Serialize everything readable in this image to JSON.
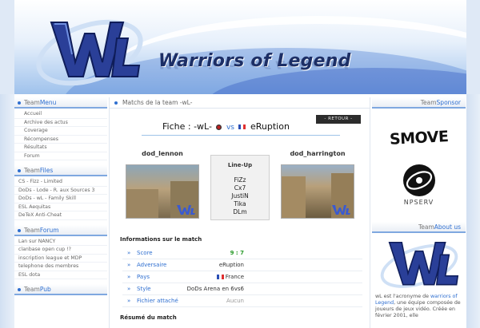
{
  "header": {
    "site_title": "Warriors of Legend"
  },
  "left_sidebar": {
    "menu_box": {
      "prefix": "Team",
      "highlight": "Menu",
      "items": [
        "Accueil",
        "Archive des actus",
        "Coverage",
        "Récompenses",
        "Résultats",
        "Forum"
      ]
    },
    "files_box": {
      "prefix": "Team",
      "highlight": "Files",
      "items": [
        "CS - Fizz - Limited",
        "DoDs - Lode - R. aux Sources 3",
        "DoDs - wL - Family Skill",
        "ESL Aequitas",
        "DeTeX Anti-Cheat"
      ]
    },
    "forum_box": {
      "prefix": "Team",
      "highlight": "Forum",
      "items": [
        "Lan sur NANCY",
        "clanbase open cup !?",
        "inscription league et MDP",
        "telephone des membres",
        "ESL dota"
      ]
    },
    "pub_box": {
      "prefix": "Team",
      "highlight": "Pub"
    }
  },
  "main": {
    "section_title": "Matchs de la team -wL-",
    "fiche": {
      "label": "Fiche : -wL-",
      "vs": "vs",
      "opponent": "eRuption"
    },
    "retour_button": "- RETOUR -",
    "player_left": "dod_lennon",
    "player_right": "dod_harrington",
    "lineup": {
      "title": "Line-Up",
      "players": [
        "FiZz",
        "Cx7",
        "JustiN",
        "Tika",
        "DLm"
      ]
    },
    "info_title": "Informations sur le match",
    "info": [
      {
        "key": "Score",
        "value": "9 : 7"
      },
      {
        "key": "Adversaire",
        "value": "eRuption"
      },
      {
        "key": "Pays",
        "value": "France"
      },
      {
        "key": "Style",
        "value": "DoDs Arena en 6vs6"
      },
      {
        "key": "Fichier attaché",
        "value": "Aucun"
      }
    ],
    "resume_title": "Résumé du match"
  },
  "right_sidebar": {
    "sponsor_box": {
      "prefix": "Team",
      "highlight": "Sponsor"
    },
    "sponsor1": "SMOVE",
    "sponsor2": "NPSERV",
    "about_box": {
      "prefix": "Team",
      "highlight": "About us"
    },
    "about_text": {
      "p1": "wL est l'acronyme de ",
      "link": "warriors of Legend",
      "p2": ", une équipe composée de joueurs de jeux vidéo. Créée en février 2001, elle"
    }
  },
  "colors": {
    "accent": "#2f6fd0",
    "score": "#2a9a2a",
    "title": "#1d2f66"
  }
}
